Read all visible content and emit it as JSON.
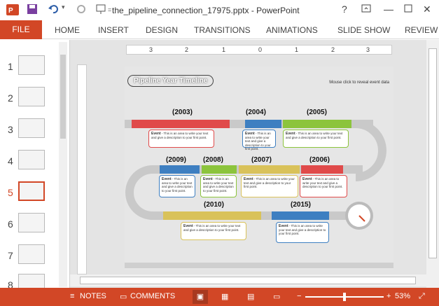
{
  "app": {
    "document_title": "the_pipeline_connection_17975.pptx - PowerPoint",
    "window_controls": [
      "?",
      "restore",
      "minimize",
      "maximize",
      "close"
    ],
    "file_tab": "FILE",
    "tabs": [
      "HOME",
      "INSERT",
      "DESIGN",
      "TRANSITIONS",
      "ANIMATIONS",
      "SLIDE SHOW",
      "REVIEW"
    ]
  },
  "thumbnails": [
    {
      "num": "1"
    },
    {
      "num": "2"
    },
    {
      "num": "3"
    },
    {
      "num": "4"
    },
    {
      "num": "5",
      "active": true
    },
    {
      "num": "6"
    },
    {
      "num": "7"
    },
    {
      "num": "8"
    }
  ],
  "ruler": {
    "labels": [
      "3",
      "2",
      "1",
      "0",
      "1",
      "2",
      "3"
    ]
  },
  "slide": {
    "title": "Pipeline Year Timeline",
    "note": "Mouse click to reveal event data",
    "years": [
      {
        "label": "(2003)",
        "event": "Event",
        "desc": "- This is an area to write your text and give a description to your first point."
      },
      {
        "label": "(2004)",
        "event": "Event",
        "desc": "- This is an area to write your text and give a description to your first point."
      },
      {
        "label": "(2005)",
        "event": "Event",
        "desc": "- This is an area to write your text and give a description to your first point."
      },
      {
        "label": "(2006)",
        "event": "Event",
        "desc": "- This is an area to write your text and give a description to your first point."
      },
      {
        "label": "(2007)",
        "event": "Event",
        "desc": "- This is an area to write your text and give a description to your first point."
      },
      {
        "label": "(2008)",
        "event": "Event",
        "desc": "- This is an area to write your text and give a description to your first point."
      },
      {
        "label": "(2009)",
        "event": "Event",
        "desc": "- This is an area to write your text and give a description to your first point."
      },
      {
        "label": "(2010)",
        "event": "Event",
        "desc": "- This is an area to write your text and give a description to your first point."
      },
      {
        "label": "(2015)",
        "event": "Event",
        "desc": "- This is an area to write your text and give a description to your first point."
      }
    ]
  },
  "status": {
    "notes": "NOTES",
    "comments": "COMMENTS",
    "zoom": "53%"
  },
  "colors": {
    "accent": "#d24726",
    "red": "#e04a4a",
    "blue": "#3e7fc1",
    "green": "#8cc43c",
    "yellow": "#d9c25a"
  }
}
